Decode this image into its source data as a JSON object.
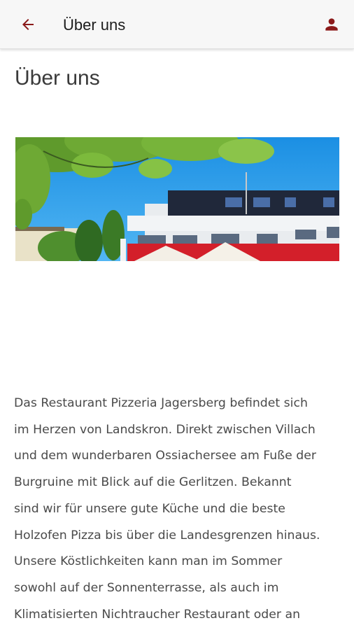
{
  "app_bar": {
    "title": "Über uns",
    "back_icon": "arrow-left-icon",
    "account_icon": "person-icon",
    "accent_color": "#8b1a1a"
  },
  "page": {
    "heading": "Über uns",
    "hero_image": "restaurant-building-photo",
    "body_lines": [
      "Das Restaurant Pizzeria Jagersberg befindet sich",
      "im Herzen von Landskron. Direkt zwischen Villach",
      "und dem wunderbaren Ossiachersee am Fuße der",
      "Burgruine mit Blick auf die Gerlitzen. Bekannt",
      "sind wir für unsere gute Küche und die beste",
      "Holzofen Pizza bis über die Landesgrenzen hinaus.",
      "Unsere Köstlichkeiten kann man im Sommer",
      "sowohl auf der Sonnenterrasse, als auch im",
      "Klimatisierten Nichtraucher Restaurant oder an"
    ]
  }
}
